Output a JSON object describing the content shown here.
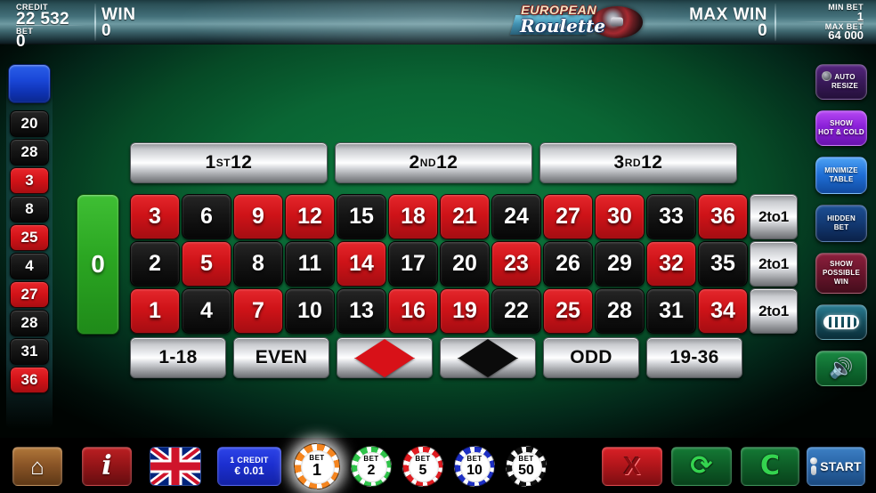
{
  "header": {
    "credit_label": "CREDIT",
    "credit_value": "22 532",
    "bet_label": "BET",
    "bet_value": "0",
    "win_label": "WIN",
    "win_value": "0",
    "max_win_label": "MAX WIN",
    "max_win_value": "0",
    "min_bet_label": "MIN BET",
    "min_bet_value": "1",
    "max_bet_label": "MAX BET",
    "max_bet_value": "64 000",
    "logo_top": "EUROPEAN",
    "logo_bottom": "Roulette"
  },
  "history": {
    "results": [
      {
        "number": "20",
        "color": "black"
      },
      {
        "number": "28",
        "color": "black"
      },
      {
        "number": "3",
        "color": "red"
      },
      {
        "number": "8",
        "color": "black"
      },
      {
        "number": "25",
        "color": "red"
      },
      {
        "number": "4",
        "color": "black"
      },
      {
        "number": "27",
        "color": "red"
      },
      {
        "number": "28",
        "color": "black"
      },
      {
        "number": "31",
        "color": "black"
      },
      {
        "number": "36",
        "color": "red"
      }
    ]
  },
  "right_rail": {
    "items": [
      {
        "name": "auto-resize",
        "line1": "AUTO",
        "line2": "RESIZE",
        "line3": ""
      },
      {
        "name": "show-hot-cold",
        "line1": "SHOW",
        "line2": "HOT & COLD",
        "line3": ""
      },
      {
        "name": "minimize-table",
        "line1": "MINIMIZE",
        "line2": "TABLE",
        "line3": ""
      },
      {
        "name": "hidden-bet",
        "line1": "HIDDEN",
        "line2": "BET",
        "line3": ""
      },
      {
        "name": "show-possible-win",
        "line1": "SHOW",
        "line2": "POSSIBLE",
        "line3": "WIN"
      }
    ]
  },
  "table": {
    "dozens": [
      {
        "main": "1",
        "sup": "ST",
        "suffix": " 12"
      },
      {
        "main": "2",
        "sup": "ND",
        "suffix": " 12"
      },
      {
        "main": "3",
        "sup": "RD",
        "suffix": " 12"
      }
    ],
    "zero": "0",
    "numbers": [
      [
        {
          "n": "3",
          "c": "red"
        },
        {
          "n": "6",
          "c": "black"
        },
        {
          "n": "9",
          "c": "red"
        },
        {
          "n": "12",
          "c": "red"
        },
        {
          "n": "15",
          "c": "black"
        },
        {
          "n": "18",
          "c": "red"
        },
        {
          "n": "21",
          "c": "red"
        },
        {
          "n": "24",
          "c": "black"
        },
        {
          "n": "27",
          "c": "red"
        },
        {
          "n": "30",
          "c": "red"
        },
        {
          "n": "33",
          "c": "black"
        },
        {
          "n": "36",
          "c": "red"
        }
      ],
      [
        {
          "n": "2",
          "c": "black"
        },
        {
          "n": "5",
          "c": "red"
        },
        {
          "n": "8",
          "c": "black"
        },
        {
          "n": "11",
          "c": "black"
        },
        {
          "n": "14",
          "c": "red"
        },
        {
          "n": "17",
          "c": "black"
        },
        {
          "n": "20",
          "c": "black"
        },
        {
          "n": "23",
          "c": "red"
        },
        {
          "n": "26",
          "c": "black"
        },
        {
          "n": "29",
          "c": "black"
        },
        {
          "n": "32",
          "c": "red"
        },
        {
          "n": "35",
          "c": "black"
        }
      ],
      [
        {
          "n": "1",
          "c": "red"
        },
        {
          "n": "4",
          "c": "black"
        },
        {
          "n": "7",
          "c": "red"
        },
        {
          "n": "10",
          "c": "black"
        },
        {
          "n": "13",
          "c": "black"
        },
        {
          "n": "16",
          "c": "red"
        },
        {
          "n": "19",
          "c": "red"
        },
        {
          "n": "22",
          "c": "black"
        },
        {
          "n": "25",
          "c": "red"
        },
        {
          "n": "28",
          "c": "black"
        },
        {
          "n": "31",
          "c": "black"
        },
        {
          "n": "34",
          "c": "red"
        }
      ]
    ],
    "column_bets": [
      "2to1",
      "2to1",
      "2to1"
    ],
    "outside": [
      {
        "name": "low",
        "label": "1-18",
        "shape": ""
      },
      {
        "name": "even",
        "label": "EVEN",
        "shape": ""
      },
      {
        "name": "red",
        "label": "",
        "shape": "diamond-red"
      },
      {
        "name": "black",
        "label": "",
        "shape": "diamond-black"
      },
      {
        "name": "odd",
        "label": "ODD",
        "shape": ""
      },
      {
        "name": "high",
        "label": "19-36",
        "shape": ""
      }
    ]
  },
  "bottom": {
    "home_icon": "⌂",
    "info_icon": "i",
    "credit_line1": "1  CREDIT",
    "credit_line2": "€ 0.01",
    "x_icon": "X",
    "rebet_icon": "⟳",
    "undo_icon": "C",
    "start_label": "START"
  },
  "chips": {
    "bet_word": "BET",
    "items": [
      {
        "value": "1",
        "color": "#f5851f",
        "selected": true
      },
      {
        "value": "2",
        "color": "#2fc44a",
        "selected": false
      },
      {
        "value": "5",
        "color": "#e01b20",
        "selected": false
      },
      {
        "value": "10",
        "color": "#1d2fc4",
        "selected": false
      },
      {
        "value": "50",
        "color": "#111111",
        "selected": false
      }
    ]
  },
  "colors": {
    "felt_green": "#0a6634",
    "red": "#cf1318",
    "black": "#151515",
    "zero_green": "#2ba622",
    "header_teal": "#43707a"
  }
}
